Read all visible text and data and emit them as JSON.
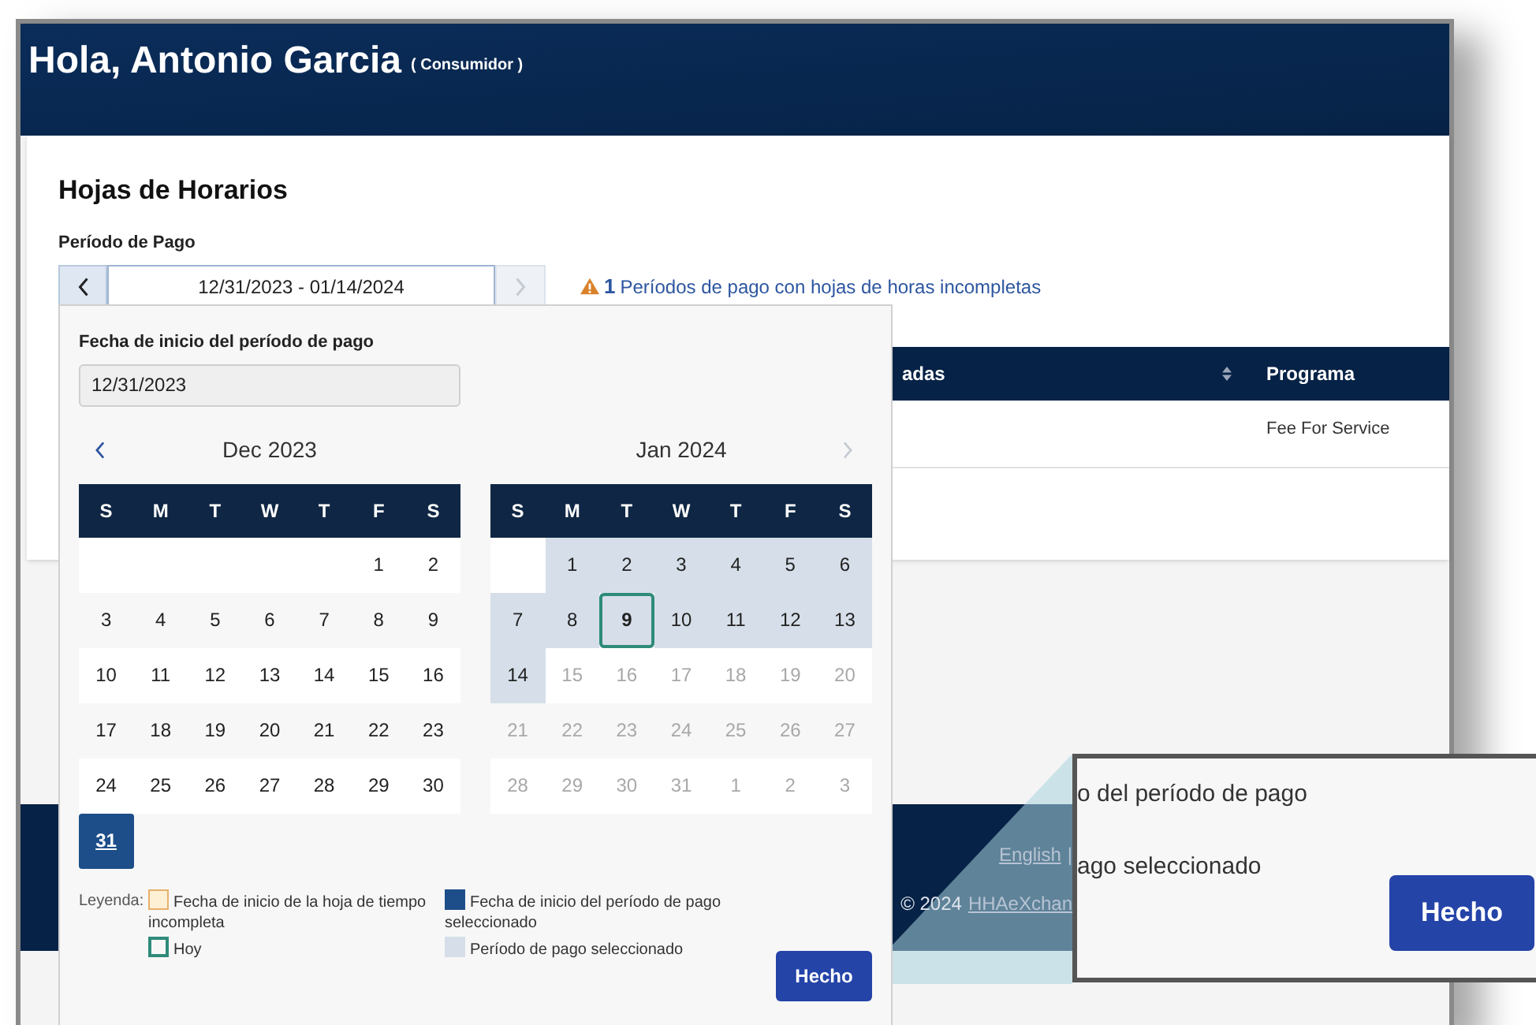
{
  "header": {
    "greeting": "Hola, Antonio Garcia",
    "role": "( Consumidor )"
  },
  "page": {
    "title": "Hojas de Horarios",
    "pay_period_label": "Período de Pago",
    "pay_period_value": "12/31/2023 - 01/14/2024",
    "prev_disabled": false,
    "next_disabled": true,
    "warning": {
      "count": "1",
      "text": "Períodos de pago con hojas de horas incompletas"
    }
  },
  "table": {
    "columns": [
      {
        "label": "adas",
        "sortable": true
      },
      {
        "label": "Programa",
        "sortable": false
      }
    ],
    "rows": [
      {
        "programa": "Fee For Service"
      }
    ]
  },
  "date_picker": {
    "start_label": "Fecha de inicio del período de pago",
    "start_value": "12/31/2023",
    "prev_disabled": false,
    "next_disabled": true,
    "months": [
      {
        "title": "Dec 2023",
        "weekdays": [
          "S",
          "M",
          "T",
          "W",
          "T",
          "F",
          "S"
        ],
        "weeks": [
          [
            {
              "kind": "blank"
            },
            {
              "kind": "blank"
            },
            {
              "kind": "blank"
            },
            {
              "kind": "blank"
            },
            {
              "kind": "blank"
            },
            {
              "d": "1",
              "kind": "normal"
            },
            {
              "d": "2",
              "kind": "normal"
            }
          ],
          [
            {
              "d": "3",
              "kind": "normal"
            },
            {
              "d": "4",
              "kind": "normal"
            },
            {
              "d": "5",
              "kind": "normal"
            },
            {
              "d": "6",
              "kind": "normal"
            },
            {
              "d": "7",
              "kind": "normal"
            },
            {
              "d": "8",
              "kind": "normal"
            },
            {
              "d": "9",
              "kind": "normal"
            }
          ],
          [
            {
              "d": "10",
              "kind": "normal"
            },
            {
              "d": "11",
              "kind": "normal"
            },
            {
              "d": "12",
              "kind": "normal"
            },
            {
              "d": "13",
              "kind": "normal"
            },
            {
              "d": "14",
              "kind": "normal"
            },
            {
              "d": "15",
              "kind": "normal"
            },
            {
              "d": "16",
              "kind": "normal"
            }
          ],
          [
            {
              "d": "17",
              "kind": "normal"
            },
            {
              "d": "18",
              "kind": "normal"
            },
            {
              "d": "19",
              "kind": "normal"
            },
            {
              "d": "20",
              "kind": "normal"
            },
            {
              "d": "21",
              "kind": "normal"
            },
            {
              "d": "22",
              "kind": "normal"
            },
            {
              "d": "23",
              "kind": "normal"
            }
          ],
          [
            {
              "d": "24",
              "kind": "normal"
            },
            {
              "d": "25",
              "kind": "normal"
            },
            {
              "d": "26",
              "kind": "normal"
            },
            {
              "d": "27",
              "kind": "normal"
            },
            {
              "d": "28",
              "kind": "normal"
            },
            {
              "d": "29",
              "kind": "normal"
            },
            {
              "d": "30",
              "kind": "normal"
            }
          ],
          [
            {
              "d": "31",
              "kind": "start"
            }
          ]
        ]
      },
      {
        "title": "Jan 2024",
        "weekdays": [
          "S",
          "M",
          "T",
          "W",
          "T",
          "F",
          "S"
        ],
        "weeks": [
          [
            {
              "kind": "blank"
            },
            {
              "d": "1",
              "kind": "period"
            },
            {
              "d": "2",
              "kind": "period"
            },
            {
              "d": "3",
              "kind": "period"
            },
            {
              "d": "4",
              "kind": "period"
            },
            {
              "d": "5",
              "kind": "period"
            },
            {
              "d": "6",
              "kind": "period"
            }
          ],
          [
            {
              "d": "7",
              "kind": "period"
            },
            {
              "d": "8",
              "kind": "period"
            },
            {
              "d": "9",
              "kind": "today"
            },
            {
              "d": "10",
              "kind": "period"
            },
            {
              "d": "11",
              "kind": "period"
            },
            {
              "d": "12",
              "kind": "period"
            },
            {
              "d": "13",
              "kind": "period"
            }
          ],
          [
            {
              "d": "14",
              "kind": "period"
            },
            {
              "d": "15",
              "kind": "disabled"
            },
            {
              "d": "16",
              "kind": "disabled"
            },
            {
              "d": "17",
              "kind": "disabled"
            },
            {
              "d": "18",
              "kind": "disabled"
            },
            {
              "d": "19",
              "kind": "disabled"
            },
            {
              "d": "20",
              "kind": "disabled"
            }
          ],
          [
            {
              "d": "21",
              "kind": "disabled"
            },
            {
              "d": "22",
              "kind": "disabled"
            },
            {
              "d": "23",
              "kind": "disabled"
            },
            {
              "d": "24",
              "kind": "disabled"
            },
            {
              "d": "25",
              "kind": "disabled"
            },
            {
              "d": "26",
              "kind": "disabled"
            },
            {
              "d": "27",
              "kind": "disabled"
            }
          ],
          [
            {
              "d": "28",
              "kind": "disabled"
            },
            {
              "d": "29",
              "kind": "disabled"
            },
            {
              "d": "30",
              "kind": "disabled"
            },
            {
              "d": "31",
              "kind": "disabled"
            },
            {
              "d": "1",
              "kind": "disabled"
            },
            {
              "d": "2",
              "kind": "disabled"
            },
            {
              "d": "3",
              "kind": "disabled"
            }
          ]
        ]
      }
    ],
    "legend_title": "Leyenda:",
    "legend": [
      {
        "kind": "incomplete",
        "text": "Fecha de inicio de la hoja de tiempo incompleta"
      },
      {
        "kind": "start",
        "text": "Fecha de inicio del período de pago seleccionado"
      },
      {
        "kind": "today",
        "text": "Hoy"
      },
      {
        "kind": "period",
        "text": "Período de pago seleccionado"
      }
    ],
    "done_button": "Hecho"
  },
  "footer": {
    "language_link": "English",
    "separator": "|",
    "copyright": "© 2024",
    "company_link": "HHAeXchan"
  },
  "callout": {
    "lines": [
      "o del período de pago",
      "ago seleccionado"
    ],
    "button": "Hecho"
  }
}
